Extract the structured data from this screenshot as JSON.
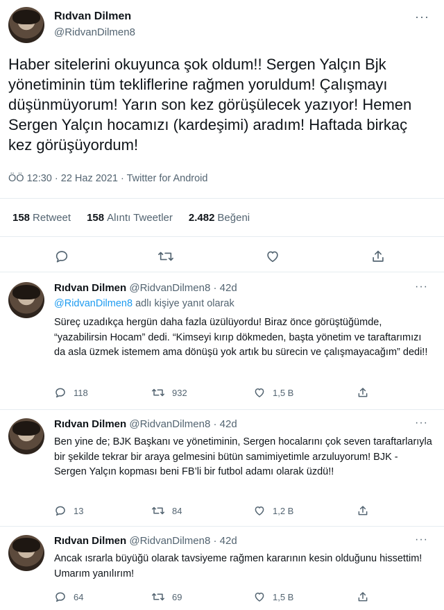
{
  "main_tweet": {
    "name": "Rıdvan Dilmen",
    "handle": "@RidvanDilmen8",
    "more": "···",
    "text": "Haber sitelerini okuyunca şok oldum!! Sergen Yalçın Bjk yönetiminin tüm tekliflerine rağmen yoruldum! Çalışmayı düşünmüyorum! Yarın son kez görüşülecek yazıyor! Hemen Sergen Yalçın hocamızı (kardeşimi) aradım! Haftada birkaç kez görüşüyordum!",
    "meta": "ÖÖ 12:30 · 22 Haz 2021 · Twitter for Android",
    "stats": [
      {
        "num": "158",
        "label": "Retweet"
      },
      {
        "num": "158",
        "label": "Alıntı Tweetler"
      },
      {
        "num": "2.482",
        "label": "Beğeni"
      }
    ],
    "actions": [
      "reply-icon",
      "retweet-icon",
      "like-icon",
      "share-icon"
    ]
  },
  "replies": [
    {
      "name": "Rıdvan Dilmen",
      "handle": "@RidvanDilmen8",
      "time": "42d",
      "more": "···",
      "replying_handle": "@RidvanDilmen8",
      "replying_text": "adlı kişiye yanıt olarak",
      "text": "Süreç uzadıkça hergün daha fazla üzülüyordu! Biraz önce görüştüğümde, “yazabilirsin Hocam” dedi. “Kimseyi kırıp dökmeden, başta yönetim ve taraftarımızı da asla üzmek istemem ama dönüşü yok artık bu sürecin ve çalışmayacağım” dedi!!",
      "replies": "118",
      "retweets": "932",
      "likes": "1,5 B"
    },
    {
      "name": "Rıdvan Dilmen",
      "handle": "@RidvanDilmen8",
      "time": "42d",
      "more": "···",
      "text": "Ben yine de; BJK Başkanı ve yönetiminin, Sergen hocalarını çok seven taraftarlarıyla bir şekilde tekrar bir araya gelmesini bütün samimiyetimle arzuluyorum! BJK - Sergen Yalçın kopması beni FB’li bir futbol adamı olarak üzdü!!",
      "replies": "13",
      "retweets": "84",
      "likes": "1,2 B"
    },
    {
      "name": "Rıdvan Dilmen",
      "handle": "@RidvanDilmen8",
      "time": "42d",
      "more": "···",
      "text": "Ancak ısrarla büyüğü olarak tavsiyeme rağmen kararının kesin olduğunu hissettim! Umarım yanılırım!",
      "replies": "64",
      "retweets": "69",
      "likes": "1,5 B"
    }
  ],
  "colors": {
    "text": "#0f1419",
    "muted": "#536471",
    "link": "#1d9bf0",
    "divider": "#e6ecf0"
  }
}
